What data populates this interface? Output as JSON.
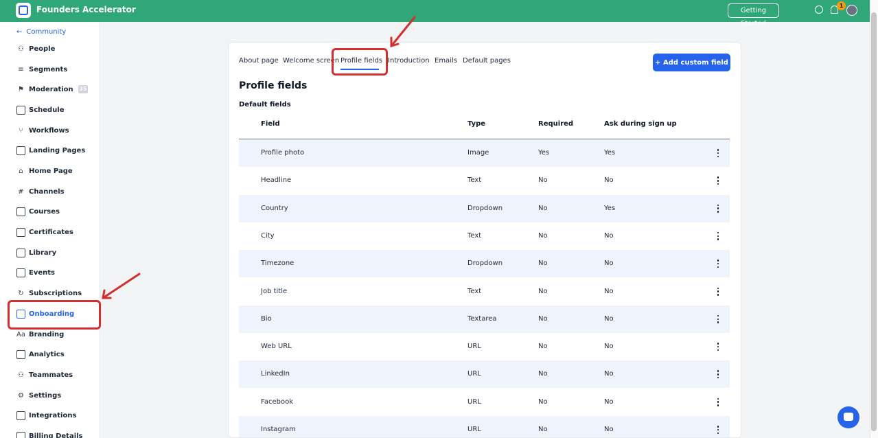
{
  "topbar": {
    "app_title": "Founders Accelerator",
    "getting_started_label": "Getting Started",
    "notification_count": "1",
    "bg_color": "#2fa779"
  },
  "sidebar": {
    "back_label": "Community",
    "items": [
      {
        "label": "People",
        "icon": "people-icon"
      },
      {
        "label": "Segments",
        "icon": "segments-icon"
      },
      {
        "label": "Moderation",
        "icon": "moderation-icon",
        "badge": "35"
      },
      {
        "label": "Schedule",
        "icon": "schedule-icon"
      },
      {
        "label": "Workflows",
        "icon": "workflows-icon"
      },
      {
        "label": "Landing Pages",
        "icon": "landing-pages-icon"
      },
      {
        "label": "Home Page",
        "icon": "home-icon"
      },
      {
        "label": "Channels",
        "icon": "hash-icon"
      },
      {
        "label": "Courses",
        "icon": "book-icon"
      },
      {
        "label": "Certificates",
        "icon": "certificate-icon"
      },
      {
        "label": "Library",
        "icon": "library-icon"
      },
      {
        "label": "Events",
        "icon": "calendar-icon"
      },
      {
        "label": "Subscriptions",
        "icon": "subscriptions-icon"
      },
      {
        "label": "Onboarding",
        "icon": "onboarding-icon",
        "active": true
      },
      {
        "label": "Branding",
        "icon": "branding-icon"
      },
      {
        "label": "Analytics",
        "icon": "analytics-icon"
      },
      {
        "label": "Teammates",
        "icon": "teammates-icon"
      },
      {
        "label": "Settings",
        "icon": "gear-icon"
      },
      {
        "label": "Integrations",
        "icon": "integrations-icon"
      },
      {
        "label": "Billing Details",
        "icon": "billing-icon"
      }
    ]
  },
  "tabs": [
    {
      "label": "About page"
    },
    {
      "label": "Welcome screen"
    },
    {
      "label": "Profile fields",
      "active": true
    },
    {
      "label": "Introduction"
    },
    {
      "label": "Emails"
    },
    {
      "label": "Default pages"
    }
  ],
  "add_button_label": "+ Add custom field",
  "page_title": "Profile fields",
  "section_title": "Default fields",
  "table": {
    "headers": [
      "Field",
      "Type",
      "Required",
      "Ask during sign up"
    ],
    "rows": [
      [
        "Profile photo",
        "Image",
        "Yes",
        "Yes"
      ],
      [
        "Headline",
        "Text",
        "No",
        "No"
      ],
      [
        "Country",
        "Dropdown",
        "No",
        "Yes"
      ],
      [
        "City",
        "Text",
        "No",
        "No"
      ],
      [
        "Timezone",
        "Dropdown",
        "No",
        "No"
      ],
      [
        "Job title",
        "Text",
        "No",
        "No"
      ],
      [
        "Bio",
        "Textarea",
        "No",
        "No"
      ],
      [
        "Web URL",
        "URL",
        "No",
        "No"
      ],
      [
        "LinkedIn",
        "URL",
        "No",
        "No"
      ],
      [
        "Facebook",
        "URL",
        "No",
        "No"
      ],
      [
        "Instagram",
        "URL",
        "No",
        "No"
      ]
    ]
  },
  "colors": {
    "accent": "#2563eb",
    "annotation": "#d32f2f",
    "row_alt": "#eef3fc"
  }
}
